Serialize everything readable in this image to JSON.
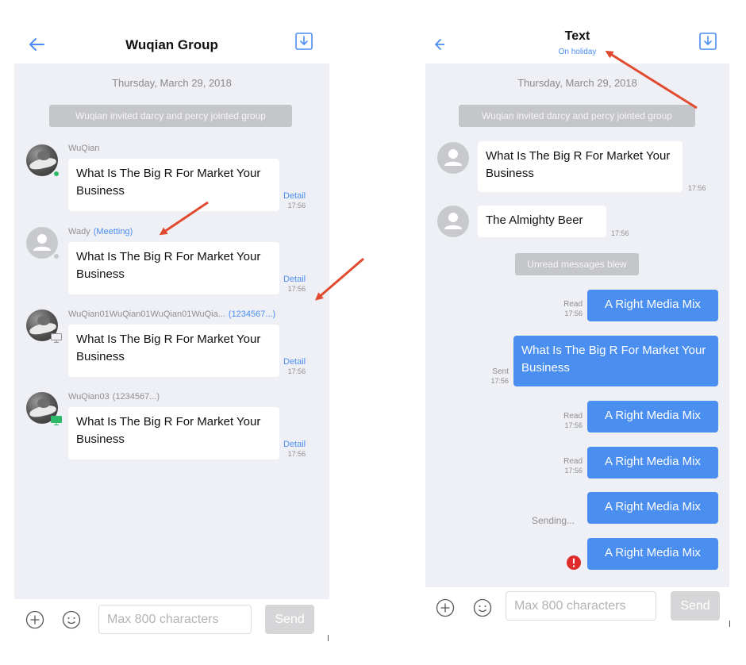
{
  "colors": {
    "accent": "#4a8ef0",
    "annotation_arrow": "#e04b30",
    "online": "#2db968",
    "error": "#e02b2b"
  },
  "left": {
    "header": {
      "title": "Wuqian Group",
      "back_icon": "arrow-left-icon",
      "action_icon": "download-icon"
    },
    "date_label": "Thursday, March 29, 2018",
    "system_message": "Wuqian invited darcy and percy jointed group",
    "messages": [
      {
        "sender": "WuQian",
        "tag": "",
        "text": "What Is The Big R For Market Your Business",
        "detail": "Detail",
        "time": "17:56"
      },
      {
        "sender": "Wady",
        "tag": "(Meetting)",
        "text": "What Is The Big R For Market Your Business",
        "detail": "Detail",
        "time": "17:56"
      },
      {
        "sender": "WuQian01WuQian01WuQian01WuQia...",
        "tag": "(1234567...)",
        "text": "What Is The Big R For Market Your Business",
        "detail": "Detail",
        "time": "17:56"
      },
      {
        "sender": "WuQian03",
        "tag": "(1234567...)",
        "text": "What Is The Big R For Market Your Business",
        "detail": "Detail",
        "time": "17:56"
      }
    ],
    "input": {
      "placeholder": "Max 800 characters",
      "send_label": "Send"
    }
  },
  "right": {
    "header": {
      "title": "Text",
      "subtitle": "On holiday",
      "back_icon": "arrow-left-icon",
      "action_icon": "download-icon"
    },
    "date_label": "Thursday, March 29, 2018",
    "system_message": "Wuqian invited darcy and percy jointed group",
    "received": [
      {
        "text": "What Is The Big R For Market Your Business",
        "time": "17:56"
      },
      {
        "text": "The Almighty Beer",
        "time": "17:56"
      }
    ],
    "unread_notice": "Unread messages blew",
    "sent": [
      {
        "text": "A Right Media Mix",
        "state": "Read",
        "time": "17:56"
      },
      {
        "text": "What Is The Big R For Market Your Business",
        "state": "Sent",
        "time": "17:56"
      },
      {
        "text": "A Right Media Mix",
        "state": "Read",
        "time": "17:56"
      },
      {
        "text": "A Right Media Mix",
        "state": "Read",
        "time": "17:56"
      },
      {
        "text": "A Right Media Mix",
        "state": "Sending...",
        "time": ""
      },
      {
        "text": "A Right Media Mix",
        "state": "",
        "time": "",
        "error": true
      }
    ],
    "input": {
      "placeholder": "Max 800 characters",
      "send_label": "Send"
    }
  }
}
